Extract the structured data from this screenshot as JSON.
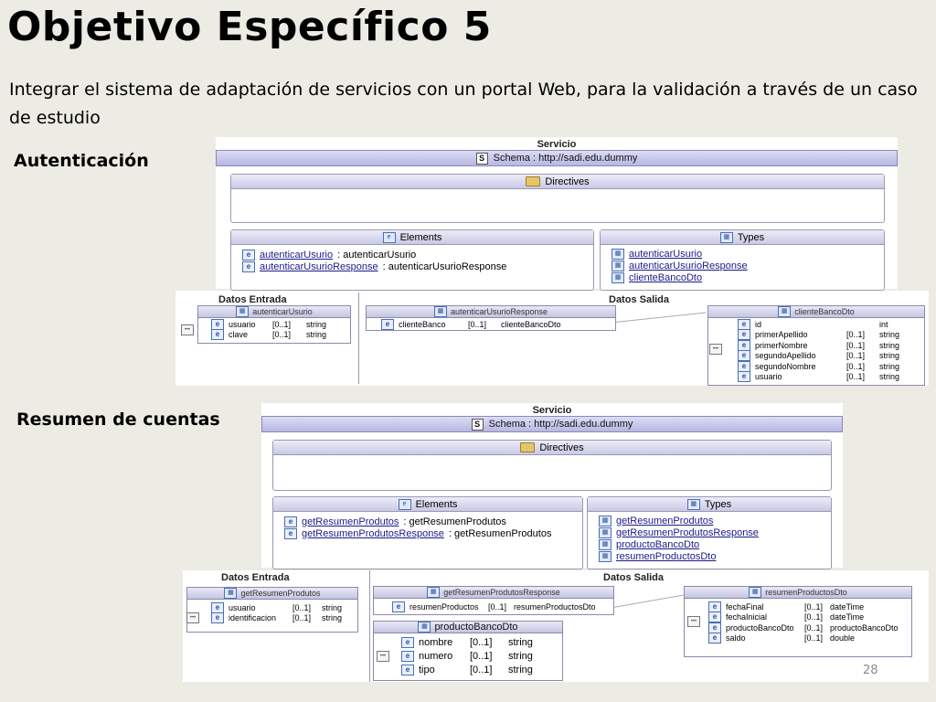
{
  "slide": {
    "title": "Objetivo Específico 5",
    "subtitle": "Integrar el sistema  de adaptación de servicios con un portal Web, para la validación a través de un caso de estudio",
    "page_number": "28"
  },
  "auth": {
    "section_label": "Autenticación",
    "service_title": "Servicio",
    "schema_label": "Schema : http://sadi.edu.dummy",
    "directives_label": "Directives",
    "elements_label": "Elements",
    "types_label": "Types",
    "elements": [
      {
        "name": "autenticarUsurio",
        "type": ": autenticarUsurio"
      },
      {
        "name": "autenticarUsurioResponse",
        "type": ": autenticarUsurioResponse"
      }
    ],
    "types": [
      "autenticarUsurio",
      "autenticarUsurioResponse",
      "clienteBancoDto"
    ],
    "datos_entrada_label": "Datos Entrada",
    "datos_salida_label": "Datos Salida",
    "entrada": {
      "title": "autenticarUsurio",
      "rows": [
        {
          "name": "usuario",
          "mult": "[0..1]",
          "type": "string"
        },
        {
          "name": "clave",
          "mult": "[0..1]",
          "type": "string"
        }
      ]
    },
    "response": {
      "title": "autenticarUsurioResponse",
      "rows": [
        {
          "name": "clienteBanco",
          "mult": "[0..1]",
          "type": "clienteBancoDto"
        }
      ]
    },
    "dto": {
      "title": "clienteBancoDto",
      "rows": [
        {
          "name": "id",
          "mult": "",
          "type": "int"
        },
        {
          "name": "primerApellido",
          "mult": "[0..1]",
          "type": "string"
        },
        {
          "name": "primerNombre",
          "mult": "[0..1]",
          "type": "string"
        },
        {
          "name": "segundoApellido",
          "mult": "[0..1]",
          "type": "string"
        },
        {
          "name": "segundoNombre",
          "mult": "[0..1]",
          "type": "string"
        },
        {
          "name": "usuario",
          "mult": "[0..1]",
          "type": "string"
        }
      ]
    }
  },
  "resumen": {
    "section_label": "Resumen de cuentas",
    "service_title": "Servicio",
    "schema_label": "Schema : http://sadi.edu.dummy",
    "directives_label": "Directives",
    "elements_label": "Elements",
    "types_label": "Types",
    "elements": [
      {
        "name": "getResumenProdutos",
        "type": ": getResumenProdutos"
      },
      {
        "name": "getResumenProdutosResponse",
        "type": ": getResumenProdutos"
      }
    ],
    "types": [
      "getResumenProdutos",
      "getResumenProdutosResponse",
      "productoBancoDto",
      "resumenProductosDto"
    ],
    "datos_entrada_label": "Datos Entrada",
    "datos_salida_label": "Datos Salida",
    "entrada": {
      "title": "getResumenProdutos",
      "rows": [
        {
          "name": "usuario",
          "mult": "[0..1]",
          "type": "string"
        },
        {
          "name": "identificacion",
          "mult": "[0..1]",
          "type": "string"
        }
      ]
    },
    "response": {
      "title": "getResumenProdutosResponse",
      "rows": [
        {
          "name": "resumenProductos",
          "mult": "[0..1]",
          "type": "resumenProductosDto"
        }
      ]
    },
    "producto": {
      "title": "productoBancoDto",
      "rows": [
        {
          "name": "nombre",
          "mult": "[0..1]",
          "type": "string"
        },
        {
          "name": "numero",
          "mult": "[0..1]",
          "type": "string"
        },
        {
          "name": "tipo",
          "mult": "[0..1]",
          "type": "string"
        }
      ]
    },
    "dto": {
      "title": "resumenProductosDto",
      "rows": [
        {
          "name": "fechaFinal",
          "mult": "[0..1]",
          "type": "dateTime"
        },
        {
          "name": "fechaInicial",
          "mult": "[0..1]",
          "type": "dateTime"
        },
        {
          "name": "productoBancoDto",
          "mult": "[0..1]",
          "type": "productoBancoDto"
        },
        {
          "name": "saldo",
          "mult": "[0..1]",
          "type": "double"
        }
      ]
    }
  }
}
